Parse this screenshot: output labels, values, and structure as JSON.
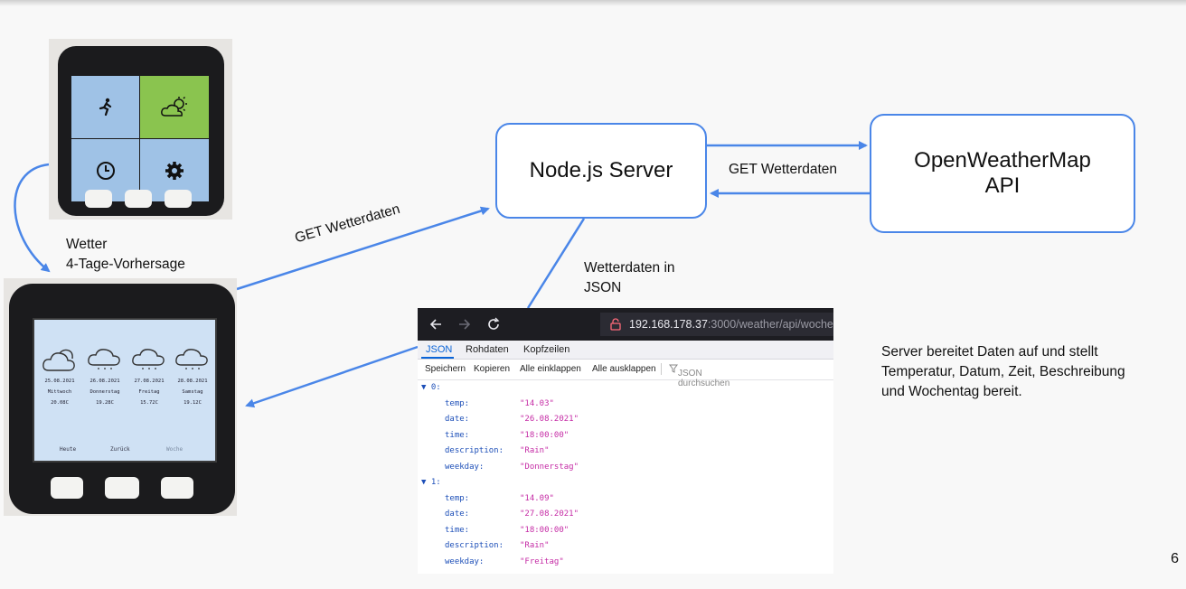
{
  "diagram": {
    "node_server": "Node.js Server",
    "api_line1": "OpenWeatherMap",
    "api_line2": "API",
    "edge_device_to_server": "GET Wetterdaten",
    "edge_server_to_api": "GET Wetterdaten",
    "edge_server_to_device_l1": "Wetterdaten in",
    "edge_server_to_device_l2": "JSON",
    "device_label_l1": "Wetter",
    "device_label_l2": "4-Tage-Vorhersage",
    "note_l1": "Server bereitet Daten auf und stellt",
    "note_l2": "Temperatur, Datum, Zeit, Beschreibung",
    "note_l3": "und Wochentag bereit.",
    "page_number": "6",
    "accent_color": "#4a86e8"
  },
  "device_menu": {
    "tiles": [
      "running-icon",
      "weather-sun-cloud-icon",
      "clock-icon",
      "gear-icon"
    ]
  },
  "device_forecast": {
    "days": [
      {
        "date": "25.08.2021",
        "weekday": "Mittwoch",
        "temp": "20.08C",
        "icon": "cloud-icon"
      },
      {
        "date": "26.08.2021",
        "weekday": "Donnerstag",
        "temp": "19.28C",
        "icon": "rain-cloud-icon"
      },
      {
        "date": "27.08.2021",
        "weekday": "Freitag",
        "temp": "15.72C",
        "icon": "rain-cloud-icon"
      },
      {
        "date": "28.08.2021",
        "weekday": "Samstag",
        "temp": "19.12C",
        "icon": "rain-cloud-icon"
      }
    ],
    "nav": {
      "left": "Heute",
      "center": "Zurück",
      "right": "Woche"
    }
  },
  "browser": {
    "url_host": "192.168.178.37",
    "url_rest": ":3000/weather/api/woche",
    "tabs": [
      "JSON",
      "Rohdaten",
      "Kopfzeilen"
    ],
    "toolbar": [
      "Speichern",
      "Kopieren",
      "Alle einklappen",
      "Alle ausklappen"
    ],
    "filter_placeholder": "JSON durchsuchen",
    "json": [
      {
        "index": "0:",
        "entries": [
          {
            "key": "temp:",
            "value": "\"14.03\""
          },
          {
            "key": "date:",
            "value": "\"26.08.2021\""
          },
          {
            "key": "time:",
            "value": "\"18:00:00\""
          },
          {
            "key": "description:",
            "value": "\"Rain\""
          },
          {
            "key": "weekday:",
            "value": "\"Donnerstag\""
          }
        ]
      },
      {
        "index": "1:",
        "entries": [
          {
            "key": "temp:",
            "value": "\"14.09\""
          },
          {
            "key": "date:",
            "value": "\"27.08.2021\""
          },
          {
            "key": "time:",
            "value": "\"18:00:00\""
          },
          {
            "key": "description:",
            "value": "\"Rain\""
          },
          {
            "key": "weekday:",
            "value": "\"Freitag\""
          }
        ]
      }
    ]
  }
}
